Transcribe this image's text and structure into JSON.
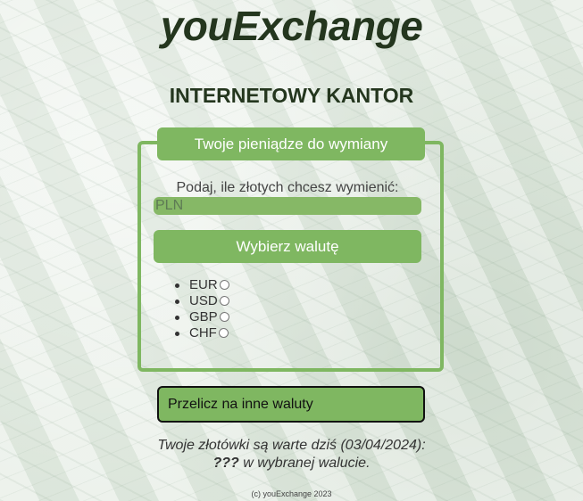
{
  "header": {
    "logo": "youExchange",
    "subtitle": "INTERNETOWY KANTOR"
  },
  "panel": {
    "title": "Twoje pieniądze do wymiany",
    "prompt": "Podaj, ile złotych chcesz wymienić:",
    "amount_placeholder": "PLN",
    "amount_value": "",
    "currency_button": "Wybierz walutę",
    "currencies": [
      "EUR",
      "USD",
      "GBP",
      "CHF"
    ]
  },
  "convert_button": "Przelicz na inne waluty",
  "result": {
    "line1": "Twoje złotówki są warte dziś (03/04/2024):",
    "value": "???",
    "line2_suffix": " w wybranej walucie."
  },
  "footer": "(c) youExchange 2023",
  "colors": {
    "accent": "#7fb761",
    "heading": "#24361e"
  }
}
